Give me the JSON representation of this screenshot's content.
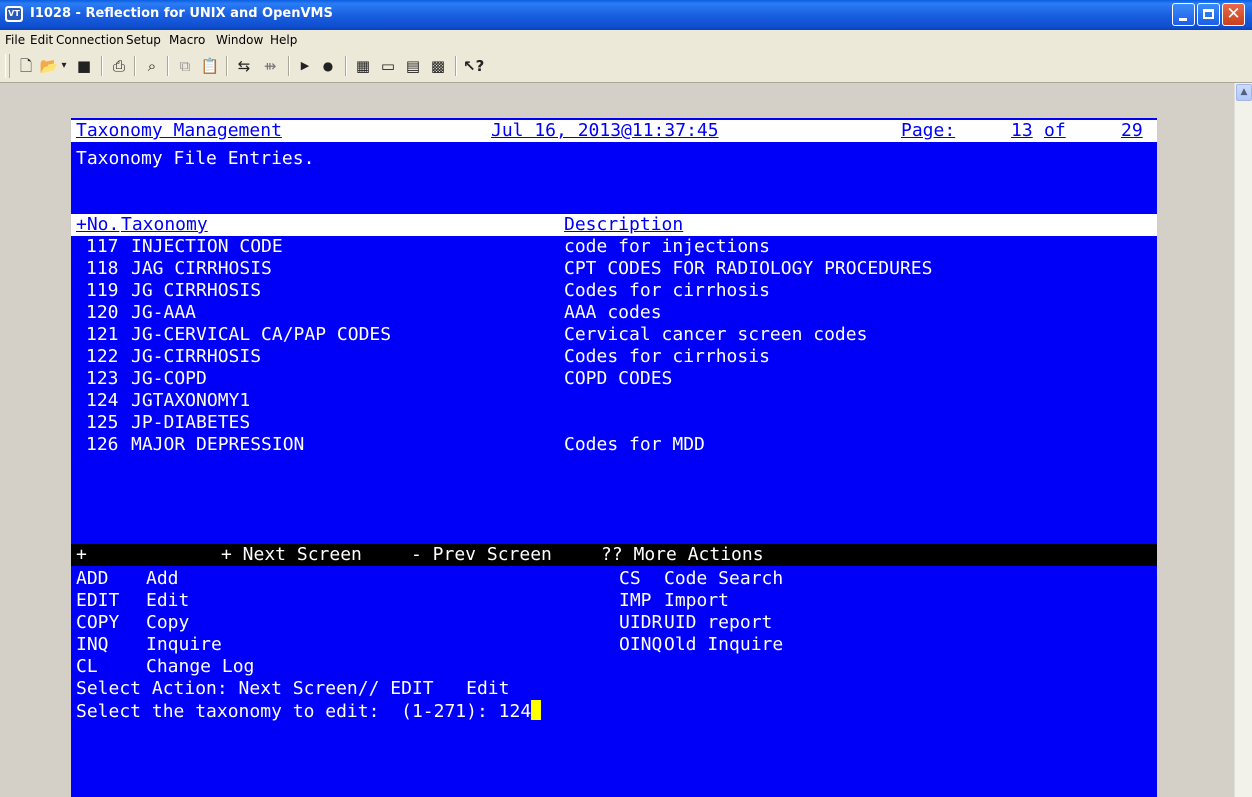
{
  "window": {
    "title": "I1028 - Reflection for UNIX and OpenVMS"
  },
  "menu": [
    "File",
    "Edit",
    "Connection",
    "Setup",
    "Macro",
    "Window",
    "Help"
  ],
  "toolbar": {
    "icons": [
      "new-icon",
      "open-icon",
      "dropdown-icon",
      "save-icon",
      "print-icon",
      "find-icon",
      "copy-icon",
      "paste-icon",
      "connect-icon",
      "disconnect-icon",
      "play-macro-icon",
      "record-macro-icon",
      "settings-icon",
      "display-icon",
      "keyboard-icon",
      "colors-icon",
      "help-icon"
    ]
  },
  "terminal": {
    "header": {
      "app": "Taxonomy Management",
      "datetime": "Jul 16, 2013@11:37:45",
      "page_label": "Page:",
      "page_current": "13",
      "page_of": "of",
      "page_total": "29"
    },
    "subtitle": "Taxonomy File Entries.",
    "columns": {
      "no": "+No.",
      "taxonomy": "Taxonomy",
      "description": "Description"
    },
    "rows": [
      {
        "no": "117",
        "name": "INJECTION CODE",
        "desc": "code for injections"
      },
      {
        "no": "118",
        "name": "JAG CIRRHOSIS",
        "desc": "CPT CODES FOR RADIOLOGY PROCEDURES"
      },
      {
        "no": "119",
        "name": "JG CIRRHOSIS",
        "desc": "Codes for cirrhosis"
      },
      {
        "no": "120",
        "name": "JG-AAA",
        "desc": "AAA codes"
      },
      {
        "no": "121",
        "name": "JG-CERVICAL CA/PAP CODES",
        "desc": "Cervical cancer screen codes"
      },
      {
        "no": "122",
        "name": "JG-CIRRHOSIS",
        "desc": "Codes for cirrhosis"
      },
      {
        "no": "123",
        "name": "JG-COPD",
        "desc": "COPD CODES"
      },
      {
        "no": "124",
        "name": "JGTAXONOMY1",
        "desc": ""
      },
      {
        "no": "125",
        "name": "JP-DIABETES",
        "desc": ""
      },
      {
        "no": "126",
        "name": "MAJOR DEPRESSION",
        "desc": "Codes for MDD"
      }
    ],
    "nav": {
      "plus": "+",
      "next": "+ Next Screen",
      "prev": "- Prev Screen",
      "more": "?? More Actions"
    },
    "actions_left": [
      {
        "code": "ADD",
        "label": "Add"
      },
      {
        "code": "EDIT",
        "label": "Edit"
      },
      {
        "code": "COPY",
        "label": "Copy"
      },
      {
        "code": "INQ",
        "label": "Inquire"
      },
      {
        "code": "CL",
        "label": "Change Log"
      }
    ],
    "actions_right": [
      {
        "code": "CS",
        "label": "Code Search"
      },
      {
        "code": "IMP",
        "label": "Import"
      },
      {
        "code": "UIDR",
        "label": "UID report"
      },
      {
        "code": "OINQ",
        "label": "Old Inquire"
      }
    ],
    "prompt1": "Select Action: Next Screen// EDIT   Edit",
    "prompt2_label": "Select the taxonomy to edit:  (1-271): ",
    "prompt2_value": "124"
  },
  "colors": {
    "terminal_bg": "#0000f8",
    "terminal_fg": "#ffffff",
    "cursor": "#ffff00",
    "titlebar": "#0a5ee0"
  }
}
